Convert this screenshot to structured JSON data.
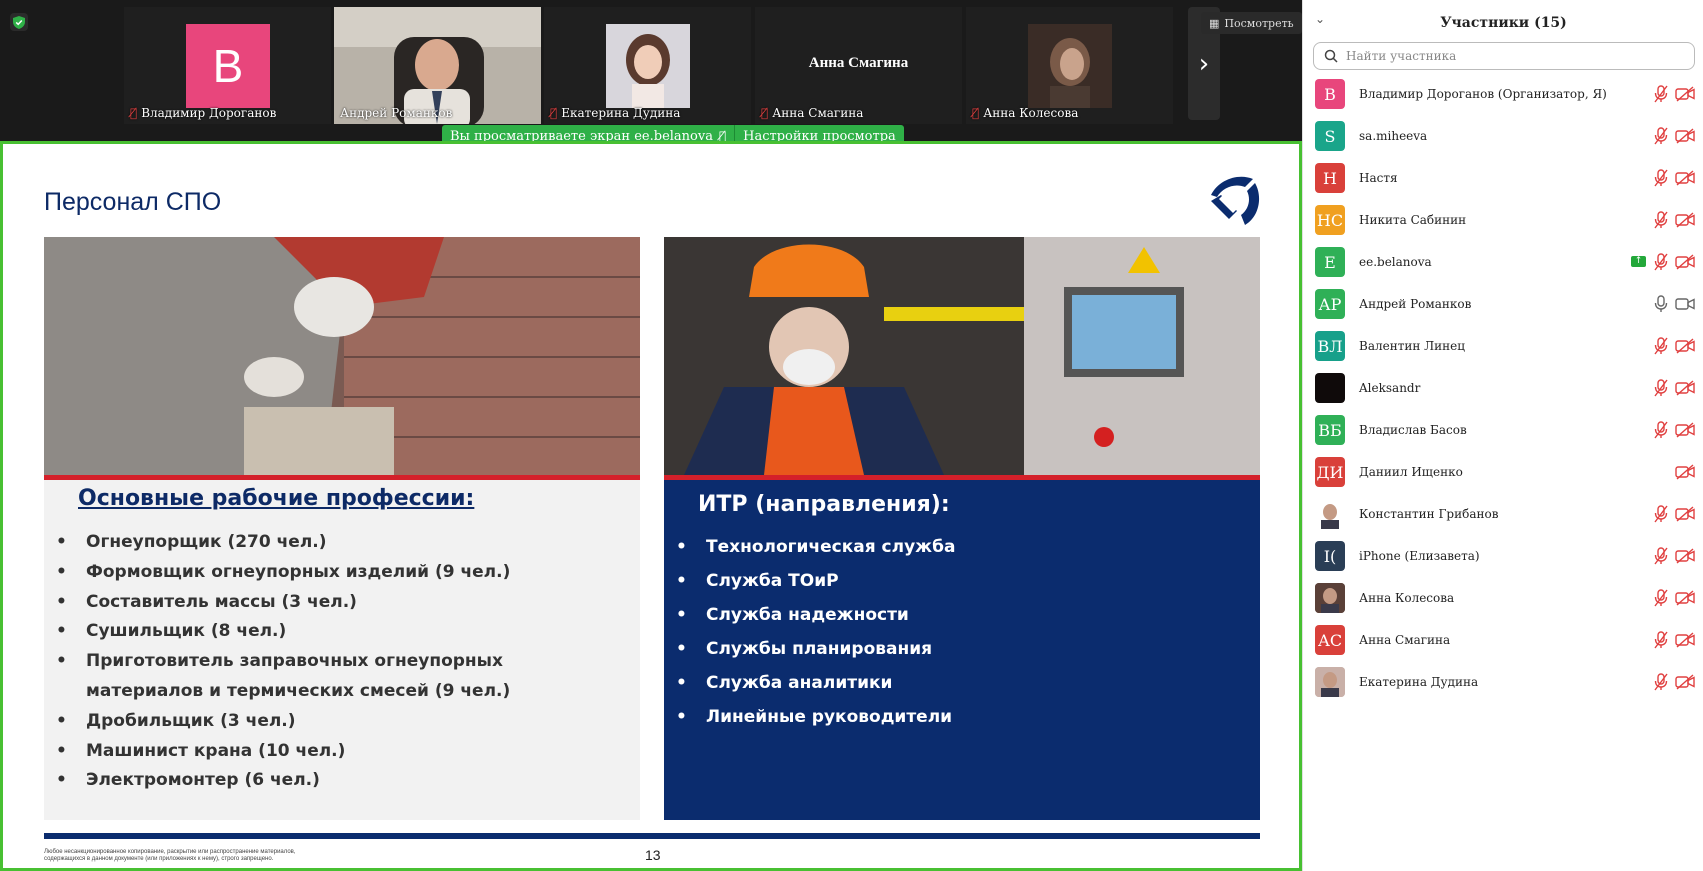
{
  "video_strip": {
    "tiles": [
      {
        "name": "Владимир Дороганов",
        "avatar_letter": "В",
        "avatar_color": "#e8467c",
        "muted": true
      },
      {
        "name": "Андрей Романков",
        "muted": false,
        "active": true
      },
      {
        "name": "Екатерина Дудина",
        "muted": true
      },
      {
        "name": "Анна Смагина",
        "center_name": "Анна Смагина",
        "muted": true
      },
      {
        "name": "Анна Колесова",
        "muted": true
      }
    ],
    "view_button": "Посмотреть",
    "next_icon": "chevron-right-icon"
  },
  "share_banner": {
    "viewing_text": "Вы просматриваете экран ее.belanova",
    "settings_text": "Настройки просмотра"
  },
  "slide": {
    "title": "Персонал СПО",
    "left_heading": "Основные рабочие профессии:",
    "left_items": [
      "Огнеупорщик (270 чел.)",
      "Формовщик огнеупорных изделий (9 чел.)",
      "Составитель массы (3 чел.)",
      "Сушильщик (8 чел.)",
      "Приготовитель заправочных огнеупорных материалов и термических смесей (9 чел.)",
      "Дробильщик (3 чел.)",
      "Машинист крана (10 чел.)",
      "Электромонтер (6 чел.)"
    ],
    "right_heading": "ИТР (направления):",
    "right_items": [
      "Технологическая служба",
      "Служба ТОиР",
      "Служба надежности",
      "Службы планирования",
      "Служба аналитики",
      "Линейные руководители"
    ],
    "footnote": "Любое несанкционированное копирование, раскрытие или распространение материалов, содержащихся в данном документе (или приложениях к нему), строго запрещено.",
    "page_number": "13",
    "colors": {
      "navy": "#0b2c6e",
      "red": "#d4202a",
      "panel_gray": "#f2f2f2"
    }
  },
  "participants": {
    "title": "Участники (15)",
    "search_placeholder": "Найти участника",
    "list": [
      {
        "initials": "В",
        "name": "Владимир Дороганов (Организатор, Я)",
        "color": "#e8467c",
        "mic": "muted",
        "cam": "off"
      },
      {
        "initials": "S",
        "name": "sa.miheeva",
        "color": "#1aa58a",
        "mic": "muted",
        "cam": "off"
      },
      {
        "initials": "Н",
        "name": "Настя",
        "color": "#d9403a",
        "mic": "muted",
        "cam": "off"
      },
      {
        "initials": "НС",
        "name": "Никита Сабинин",
        "color": "#f0a020",
        "mic": "muted",
        "cam": "off"
      },
      {
        "initials": "E",
        "name": "ee.belanova",
        "color": "#2fb057",
        "mic": "muted",
        "cam": "off",
        "sharing": true
      },
      {
        "initials": "АР",
        "name": "Андрей Романков",
        "color": "#2fb057",
        "mic": "on",
        "cam": "on"
      },
      {
        "initials": "ВЛ",
        "name": "Валентин Линец",
        "color": "#17a08a",
        "mic": "muted",
        "cam": "off"
      },
      {
        "initials": "",
        "name": "Aleksandr",
        "color": "#0f0a0a",
        "mic": "muted",
        "cam": "off"
      },
      {
        "initials": "ВБ",
        "name": "Владислав Басов",
        "color": "#2fb057",
        "mic": "muted",
        "cam": "off"
      },
      {
        "initials": "ДИ",
        "name": "Даниил Ищенко",
        "color": "#d9403a",
        "mic": "none",
        "cam": "off"
      },
      {
        "initials": "",
        "name": "Константин Грибанов",
        "color": "#ffffff",
        "photo": "person-photo",
        "mic": "muted",
        "cam": "off"
      },
      {
        "initials": "I(",
        "name": "iPhone (Елизавета)",
        "color": "#2a3e56",
        "mic": "muted",
        "cam": "off"
      },
      {
        "initials": "",
        "name": "Анна Колесова",
        "color": "#5a4038",
        "photo": "person-photo",
        "mic": "muted",
        "cam": "off"
      },
      {
        "initials": "АС",
        "name": "Анна Смагина",
        "color": "#d9403a",
        "mic": "muted",
        "cam": "off"
      },
      {
        "initials": "",
        "name": "Екатерина Дудина",
        "color": "#c9b0a8",
        "photo": "person-photo",
        "mic": "muted",
        "cam": "off"
      }
    ]
  }
}
